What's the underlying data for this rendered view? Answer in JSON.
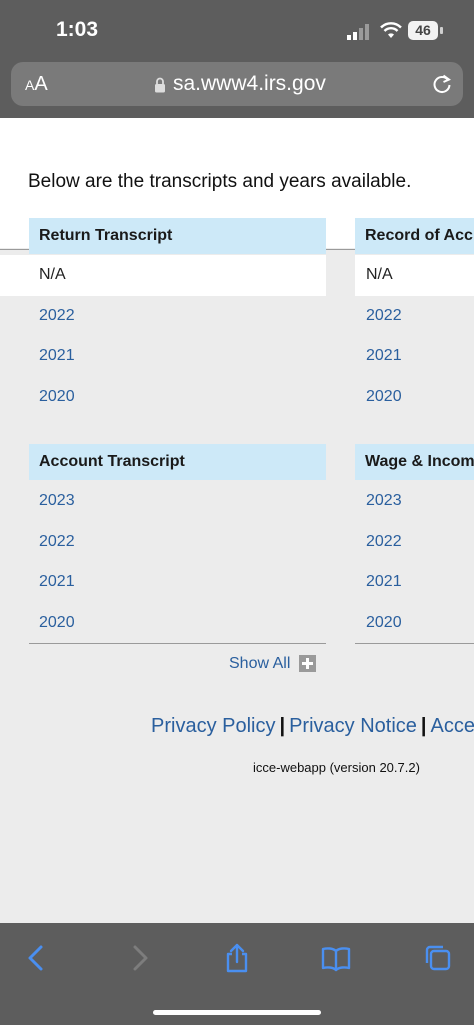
{
  "status_bar": {
    "time": "1:03",
    "battery": "46"
  },
  "url_bar": {
    "text_size_label_small": "A",
    "text_size_label_large": "A",
    "url": "sa.www4.irs.gov"
  },
  "main": {
    "intro": "Below are the transcripts and years available.",
    "panels": [
      {
        "title": "Return Transcript",
        "rows": [
          "N/A",
          "2022",
          "2021",
          "2020"
        ]
      },
      {
        "title": "Record of Acc",
        "rows": [
          "N/A",
          "2022",
          "2021",
          "2020"
        ]
      },
      {
        "title": "Account Transcript",
        "rows": [
          "2023",
          "2022",
          "2021",
          "2020"
        ]
      },
      {
        "title": "Wage & Incom",
        "rows": [
          "2023",
          "2022",
          "2021",
          "2020"
        ]
      }
    ],
    "show_all": "Show All"
  },
  "footer": {
    "links": [
      "Privacy Policy",
      "Privacy Notice",
      "Access"
    ],
    "separator": "|",
    "version": "icce-webapp (version 20.7.2)"
  },
  "colors": {
    "chrome": "#5d5d5d",
    "header_bg": "#cde9f8",
    "link": "#2a5f9e",
    "page_bg": "#ececec"
  },
  "icons": {
    "toolbar": [
      "back-icon",
      "forward-icon",
      "share-icon",
      "bookmarks-icon",
      "tabs-icon"
    ]
  }
}
